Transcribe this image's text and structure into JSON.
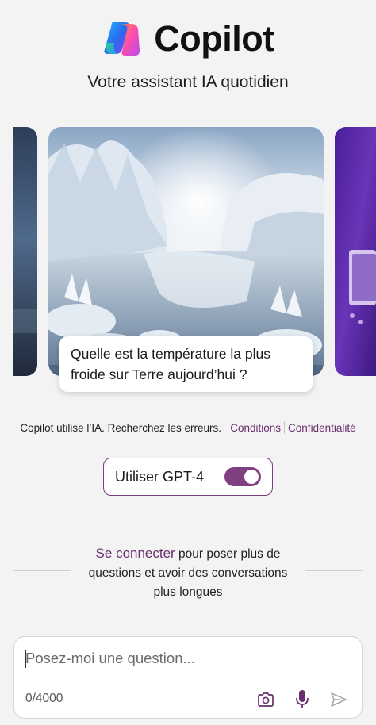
{
  "header": {
    "app_title": "Copilot",
    "subtitle": "Votre assistant IA quotidien",
    "logo_icon": "copilot-logo"
  },
  "carousel": {
    "prompt": "Quelle est la température la plus froide sur Terre aujourd’hui ?"
  },
  "disclaimer": {
    "text": "Copilot utilise l’IA. Recherchez les erreurs.",
    "terms_link": "Conditions",
    "privacy_link": "Confidentialité"
  },
  "gpt_toggle": {
    "label": "Utiliser GPT-4",
    "enabled": true
  },
  "signin": {
    "link": "Se connecter",
    "text": " pour poser plus de questions et avoir des conversations plus longues"
  },
  "composer": {
    "placeholder": "Posez-moi une question...",
    "counter": "0/4000",
    "icons": [
      "camera-icon",
      "microphone-icon",
      "send-icon"
    ]
  },
  "colors": {
    "accent": "#6b2f6e",
    "toggle_on": "#80407f",
    "background": "#f3f3f3"
  }
}
